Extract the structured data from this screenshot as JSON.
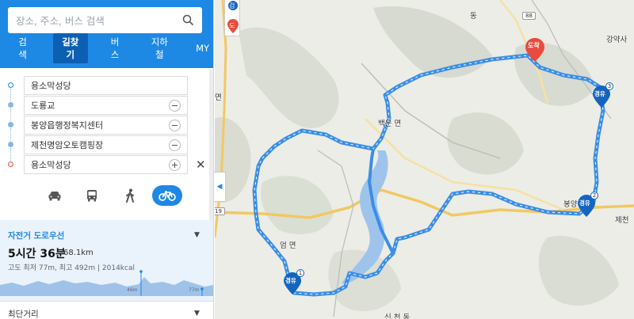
{
  "search": {
    "placeholder": "장소, 주소, 버스 검색"
  },
  "nav": [
    "검색",
    "길찾기",
    "버스",
    "지하철",
    "MY"
  ],
  "route": {
    "start": "용소막성당",
    "waypoints": [
      "도룡교",
      "봉양읍행정복지센터",
      "제천명암오토캠핑장"
    ],
    "end": "용소막성당",
    "remove_glyph": "−",
    "add_glyph": "+",
    "close_glyph": "✕"
  },
  "modes": [
    {
      "icon": "car-icon",
      "active": false
    },
    {
      "icon": "bus-icon",
      "active": false
    },
    {
      "icon": "walk-icon",
      "active": false
    },
    {
      "icon": "bike-icon",
      "active": true
    }
  ],
  "result": {
    "title": "자전거 도로우선",
    "time": "5시간 36분",
    "distance": "68.1km",
    "info": "고도 최저 77m, 최고 492m  |  2014kcal",
    "elev_label_1": "46m",
    "elev_label_2": "77m"
  },
  "alt_route": "최단거리",
  "map": {
    "labels": {
      "dong": "동",
      "gangyaksa": "강약사",
      "myeon1": "면",
      "baegun": "백운 면",
      "bongyang": "봉양 읍",
      "jecheon": "제천",
      "eom": "엄  면",
      "sincheon": "신 천 동",
      "route88": "88",
      "route19": "19",
      "route_d": "도",
      "legend": "검"
    },
    "markers": [
      {
        "label": "도착",
        "color": "#e74c3c"
      },
      {
        "label": "경유",
        "num": "1",
        "color": "#1565c0"
      },
      {
        "label": "경유",
        "num": "2",
        "color": "#1565c0"
      },
      {
        "label": "경유",
        "num": "3",
        "color": "#1565c0"
      }
    ],
    "colors": {
      "route": "#3b8ee6",
      "water": "#9ec4ec",
      "road": "#f1c863"
    }
  }
}
